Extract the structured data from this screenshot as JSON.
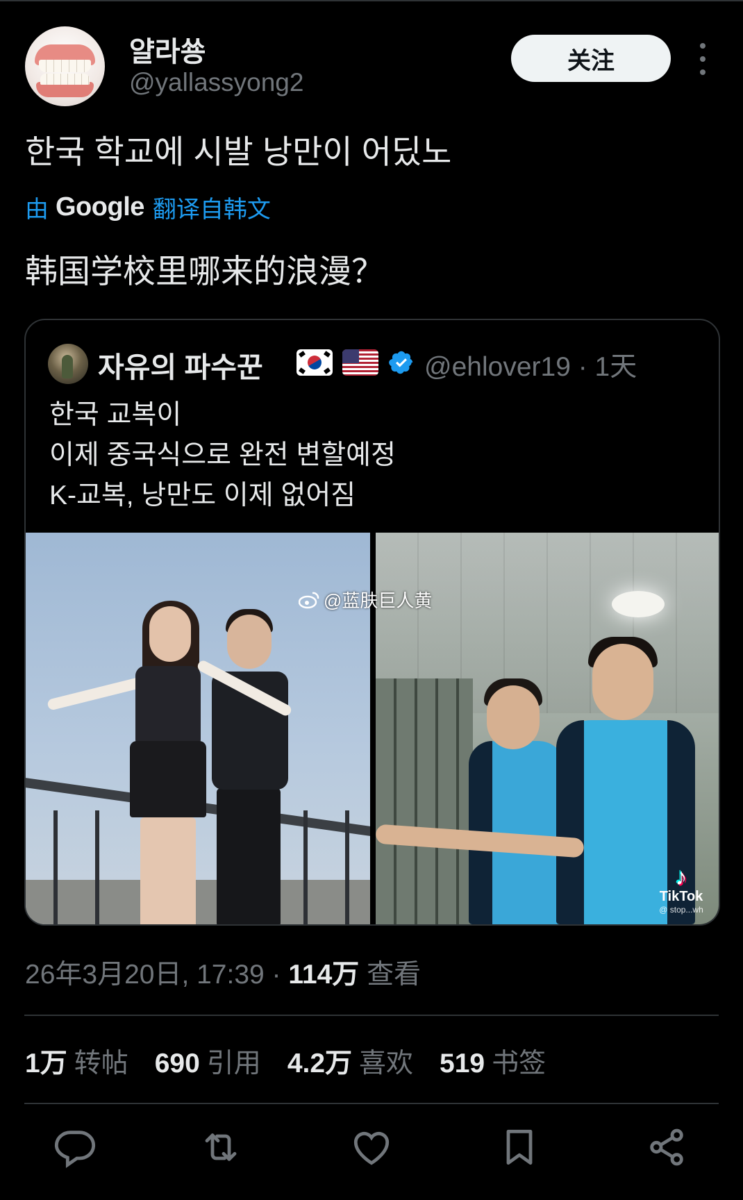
{
  "author": {
    "display_name": "얄라쑝",
    "handle": "@yallassyong2",
    "follow_label": "关注",
    "avatar_icon": "denture-avatar"
  },
  "tweet": {
    "text": "한국 학교에 시발 낭만이 어딨노",
    "translate_prefix": "由",
    "translate_brand": "Google",
    "translate_suffix": "翻译自韩文",
    "translated_text": "韩国学校里哪来的浪漫？"
  },
  "quote": {
    "display_name": "자유의 파수꾼",
    "flags": [
      "flag-south-korea-icon",
      "flag-usa-icon"
    ],
    "verified_icon": "verified-badge-icon",
    "handle_time": "@ehlover19 · 1天",
    "lines": [
      "한국 교복이",
      "이제 중국식으로 완전 변할예정",
      "K-교복, 낭만도 이제 없어짐"
    ],
    "tiktok_label": "TikTok",
    "tiktok_user": "@ stop...wh",
    "watermark": "@蓝肤巨人黄"
  },
  "meta": {
    "timestamp": "26年3月20日, 17:39 · ",
    "views_count": "114万",
    "views_label": " 查看"
  },
  "stats": [
    {
      "count": "1万",
      "label": "转帖"
    },
    {
      "count": "690",
      "label": "引用"
    },
    {
      "count": "4.2万",
      "label": "喜欢"
    },
    {
      "count": "519",
      "label": "书签"
    }
  ],
  "actions": [
    "reply-icon",
    "repost-icon",
    "like-icon",
    "bookmark-icon",
    "share-icon"
  ],
  "colors": {
    "background": "#000000",
    "text": "#e7e9ea",
    "muted": "#71767b",
    "link": "#1d9bf0",
    "border": "#2f3336",
    "follow_bg": "#eff3f4"
  }
}
